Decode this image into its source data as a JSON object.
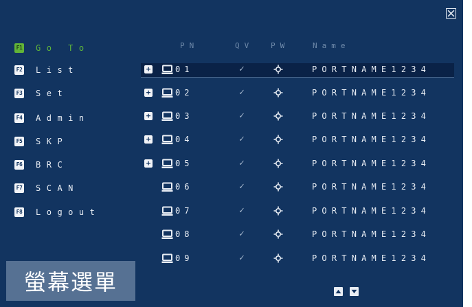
{
  "menu": [
    {
      "key": "F1",
      "label": "Go To",
      "active": true
    },
    {
      "key": "F2",
      "label": "List"
    },
    {
      "key": "F3",
      "label": "Set"
    },
    {
      "key": "F4",
      "label": "Admin"
    },
    {
      "key": "F5",
      "label": "SKP"
    },
    {
      "key": "F6",
      "label": "BRC"
    },
    {
      "key": "F7",
      "label": "SCAN"
    },
    {
      "key": "F8",
      "label": "Logout"
    }
  ],
  "columns": {
    "pn": "PN",
    "qv": "QV",
    "pw": "PW",
    "name": "Name"
  },
  "ports": [
    {
      "pn": "01",
      "expandable": true,
      "qv": "✓",
      "name": "PORTNAME1234",
      "selected": true
    },
    {
      "pn": "02",
      "expandable": true,
      "qv": "✓",
      "name": "PORTNAME1234"
    },
    {
      "pn": "03",
      "expandable": true,
      "qv": "✓",
      "name": "PORTNAME1234"
    },
    {
      "pn": "04",
      "expandable": true,
      "qv": "✓",
      "name": "PORTNAME1234"
    },
    {
      "pn": "05",
      "expandable": true,
      "qv": "✓",
      "name": "PORTNAME1234"
    },
    {
      "pn": "06",
      "expandable": false,
      "qv": "✓",
      "name": "PORTNAME1234"
    },
    {
      "pn": "07",
      "expandable": false,
      "qv": "✓",
      "name": "PORTNAME1234"
    },
    {
      "pn": "08",
      "expandable": false,
      "qv": "✓",
      "name": "PORTNAME1234"
    },
    {
      "pn": "09",
      "expandable": false,
      "qv": "✓",
      "name": "PORTNAME1234"
    }
  ],
  "watermark": "螢幕選單",
  "icons": {
    "close": "close-icon",
    "expand": "plus-icon",
    "port": "computer-icon",
    "power": "power-icon",
    "scroll_up": "arrow-up-icon",
    "scroll_down": "arrow-down-icon"
  },
  "colors": {
    "background": "#123460",
    "accent": "#5fb83a",
    "text": "#e8edf4",
    "header": "#6f8aaa"
  }
}
